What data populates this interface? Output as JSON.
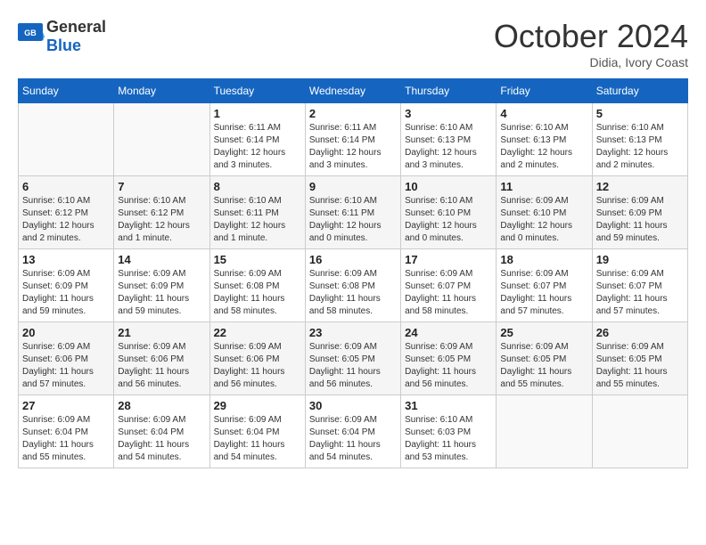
{
  "header": {
    "logo_general": "General",
    "logo_blue": "Blue",
    "month": "October 2024",
    "location": "Didia, Ivory Coast"
  },
  "weekdays": [
    "Sunday",
    "Monday",
    "Tuesday",
    "Wednesday",
    "Thursday",
    "Friday",
    "Saturday"
  ],
  "weeks": [
    [
      {
        "day": "",
        "info": ""
      },
      {
        "day": "",
        "info": ""
      },
      {
        "day": "1",
        "info": "Sunrise: 6:11 AM\nSunset: 6:14 PM\nDaylight: 12 hours\nand 3 minutes."
      },
      {
        "day": "2",
        "info": "Sunrise: 6:11 AM\nSunset: 6:14 PM\nDaylight: 12 hours\nand 3 minutes."
      },
      {
        "day": "3",
        "info": "Sunrise: 6:10 AM\nSunset: 6:13 PM\nDaylight: 12 hours\nand 3 minutes."
      },
      {
        "day": "4",
        "info": "Sunrise: 6:10 AM\nSunset: 6:13 PM\nDaylight: 12 hours\nand 2 minutes."
      },
      {
        "day": "5",
        "info": "Sunrise: 6:10 AM\nSunset: 6:13 PM\nDaylight: 12 hours\nand 2 minutes."
      }
    ],
    [
      {
        "day": "6",
        "info": "Sunrise: 6:10 AM\nSunset: 6:12 PM\nDaylight: 12 hours\nand 2 minutes."
      },
      {
        "day": "7",
        "info": "Sunrise: 6:10 AM\nSunset: 6:12 PM\nDaylight: 12 hours\nand 1 minute."
      },
      {
        "day": "8",
        "info": "Sunrise: 6:10 AM\nSunset: 6:11 PM\nDaylight: 12 hours\nand 1 minute."
      },
      {
        "day": "9",
        "info": "Sunrise: 6:10 AM\nSunset: 6:11 PM\nDaylight: 12 hours\nand 0 minutes."
      },
      {
        "day": "10",
        "info": "Sunrise: 6:10 AM\nSunset: 6:10 PM\nDaylight: 12 hours\nand 0 minutes."
      },
      {
        "day": "11",
        "info": "Sunrise: 6:09 AM\nSunset: 6:10 PM\nDaylight: 12 hours\nand 0 minutes."
      },
      {
        "day": "12",
        "info": "Sunrise: 6:09 AM\nSunset: 6:09 PM\nDaylight: 11 hours\nand 59 minutes."
      }
    ],
    [
      {
        "day": "13",
        "info": "Sunrise: 6:09 AM\nSunset: 6:09 PM\nDaylight: 11 hours\nand 59 minutes."
      },
      {
        "day": "14",
        "info": "Sunrise: 6:09 AM\nSunset: 6:09 PM\nDaylight: 11 hours\nand 59 minutes."
      },
      {
        "day": "15",
        "info": "Sunrise: 6:09 AM\nSunset: 6:08 PM\nDaylight: 11 hours\nand 58 minutes."
      },
      {
        "day": "16",
        "info": "Sunrise: 6:09 AM\nSunset: 6:08 PM\nDaylight: 11 hours\nand 58 minutes."
      },
      {
        "day": "17",
        "info": "Sunrise: 6:09 AM\nSunset: 6:07 PM\nDaylight: 11 hours\nand 58 minutes."
      },
      {
        "day": "18",
        "info": "Sunrise: 6:09 AM\nSunset: 6:07 PM\nDaylight: 11 hours\nand 57 minutes."
      },
      {
        "day": "19",
        "info": "Sunrise: 6:09 AM\nSunset: 6:07 PM\nDaylight: 11 hours\nand 57 minutes."
      }
    ],
    [
      {
        "day": "20",
        "info": "Sunrise: 6:09 AM\nSunset: 6:06 PM\nDaylight: 11 hours\nand 57 minutes."
      },
      {
        "day": "21",
        "info": "Sunrise: 6:09 AM\nSunset: 6:06 PM\nDaylight: 11 hours\nand 56 minutes."
      },
      {
        "day": "22",
        "info": "Sunrise: 6:09 AM\nSunset: 6:06 PM\nDaylight: 11 hours\nand 56 minutes."
      },
      {
        "day": "23",
        "info": "Sunrise: 6:09 AM\nSunset: 6:05 PM\nDaylight: 11 hours\nand 56 minutes."
      },
      {
        "day": "24",
        "info": "Sunrise: 6:09 AM\nSunset: 6:05 PM\nDaylight: 11 hours\nand 56 minutes."
      },
      {
        "day": "25",
        "info": "Sunrise: 6:09 AM\nSunset: 6:05 PM\nDaylight: 11 hours\nand 55 minutes."
      },
      {
        "day": "26",
        "info": "Sunrise: 6:09 AM\nSunset: 6:05 PM\nDaylight: 11 hours\nand 55 minutes."
      }
    ],
    [
      {
        "day": "27",
        "info": "Sunrise: 6:09 AM\nSunset: 6:04 PM\nDaylight: 11 hours\nand 55 minutes."
      },
      {
        "day": "28",
        "info": "Sunrise: 6:09 AM\nSunset: 6:04 PM\nDaylight: 11 hours\nand 54 minutes."
      },
      {
        "day": "29",
        "info": "Sunrise: 6:09 AM\nSunset: 6:04 PM\nDaylight: 11 hours\nand 54 minutes."
      },
      {
        "day": "30",
        "info": "Sunrise: 6:09 AM\nSunset: 6:04 PM\nDaylight: 11 hours\nand 54 minutes."
      },
      {
        "day": "31",
        "info": "Sunrise: 6:10 AM\nSunset: 6:03 PM\nDaylight: 11 hours\nand 53 minutes."
      },
      {
        "day": "",
        "info": ""
      },
      {
        "day": "",
        "info": ""
      }
    ]
  ]
}
